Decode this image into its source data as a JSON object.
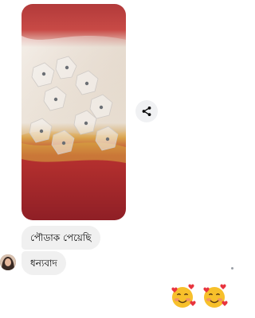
{
  "thread": {
    "messages": [
      {
        "type": "photo",
        "icon": "photo-of-clear-adhesive-wall-hooks"
      },
      {
        "type": "text",
        "text": "পৌডাক পেয়েছি"
      },
      {
        "type": "text",
        "text": "ধন্যবাদ"
      }
    ],
    "share_icon": "share-icon",
    "reactions": [
      "smiling-face-with-hearts",
      "smiling-face-with-hearts"
    ]
  },
  "colors": {
    "bubble_bg": "#f0f0f0",
    "text": "#050505",
    "share_bg": "#f0f1f3"
  }
}
